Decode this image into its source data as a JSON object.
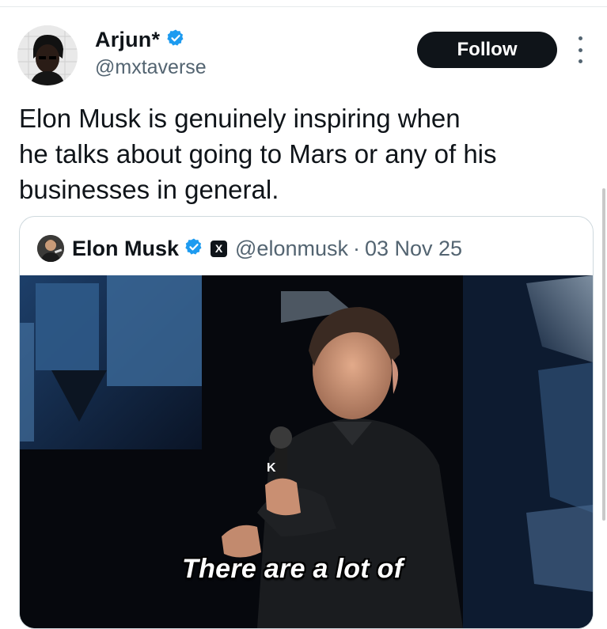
{
  "author": {
    "display_name": "Arjun*",
    "handle": "@mxtaverse",
    "verified_icon": "verified-badge-icon"
  },
  "follow_label": "Follow",
  "tweet_text": "Elon Musk is genuinely inspiring when\nhe talks about going to Mars or any of his\nbusinesses in general.",
  "quote": {
    "display_name": "Elon Musk",
    "handle": "@elonmusk",
    "separator": "·",
    "date": "03 Nov 25",
    "affiliate_badge": "X",
    "media_subtitle": "There are a lot of"
  },
  "colors": {
    "verified": "#1d9bf0",
    "follow_bg": "#0f1419",
    "secondary_text": "#536471"
  }
}
